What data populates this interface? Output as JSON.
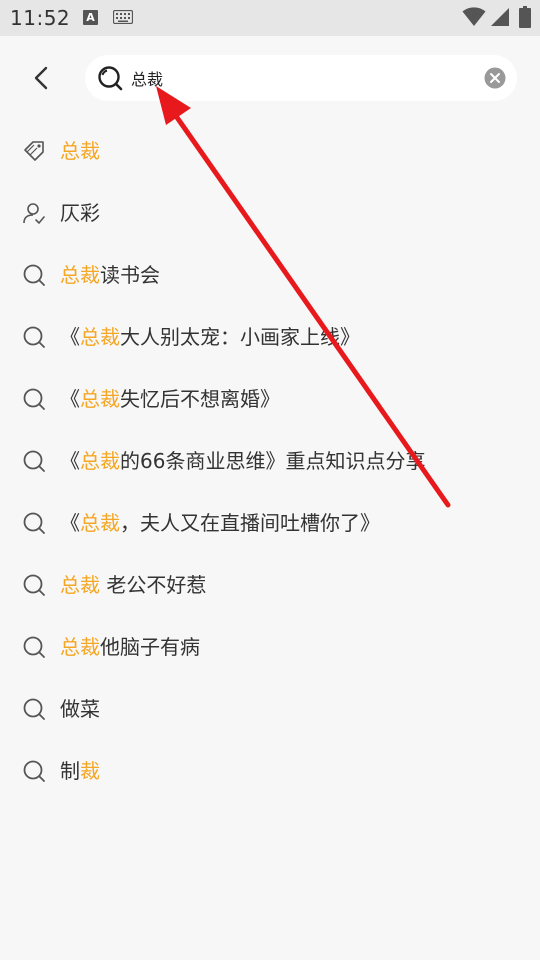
{
  "status_bar": {
    "time": "11:52",
    "notification_icon_letter": "A"
  },
  "search": {
    "value": "总裁",
    "placeholder": ""
  },
  "results": [
    {
      "icon": "tag-icon",
      "parts": [
        {
          "text": "总裁",
          "hl": true
        }
      ]
    },
    {
      "icon": "user-icon",
      "parts": [
        {
          "text": "仄彩",
          "hl": false
        }
      ]
    },
    {
      "icon": "search-icon",
      "parts": [
        {
          "text": "总裁",
          "hl": true
        },
        {
          "text": "读书会",
          "hl": false
        }
      ]
    },
    {
      "icon": "search-icon",
      "parts": [
        {
          "text": "《",
          "hl": false
        },
        {
          "text": "总裁",
          "hl": true
        },
        {
          "text": "大人别太宠：小画家上线》",
          "hl": false
        }
      ]
    },
    {
      "icon": "search-icon",
      "parts": [
        {
          "text": "《",
          "hl": false
        },
        {
          "text": "总裁",
          "hl": true
        },
        {
          "text": "失忆后不想离婚》",
          "hl": false
        }
      ]
    },
    {
      "icon": "search-icon",
      "parts": [
        {
          "text": "《",
          "hl": false
        },
        {
          "text": "总裁",
          "hl": true
        },
        {
          "text": "的66条商业思维》重点知识点分享",
          "hl": false
        }
      ]
    },
    {
      "icon": "search-icon",
      "parts": [
        {
          "text": "《",
          "hl": false
        },
        {
          "text": "总裁",
          "hl": true
        },
        {
          "text": "，夫人又在直播间吐槽你了》",
          "hl": false
        }
      ]
    },
    {
      "icon": "search-icon",
      "parts": [
        {
          "text": "总裁",
          "hl": true
        },
        {
          "text": " 老公不好惹",
          "hl": false
        }
      ]
    },
    {
      "icon": "search-icon",
      "parts": [
        {
          "text": "总裁",
          "hl": true
        },
        {
          "text": "他脑子有病",
          "hl": false
        }
      ]
    },
    {
      "icon": "search-icon",
      "parts": [
        {
          "text": "做菜",
          "hl": false
        }
      ]
    },
    {
      "icon": "search-icon",
      "parts": [
        {
          "text": "制",
          "hl": false
        },
        {
          "text": "裁",
          "hl": true
        }
      ]
    }
  ],
  "colors": {
    "highlight": "#f5a623",
    "annotation_arrow": "#e8191c",
    "background": "#f7f7f7"
  }
}
